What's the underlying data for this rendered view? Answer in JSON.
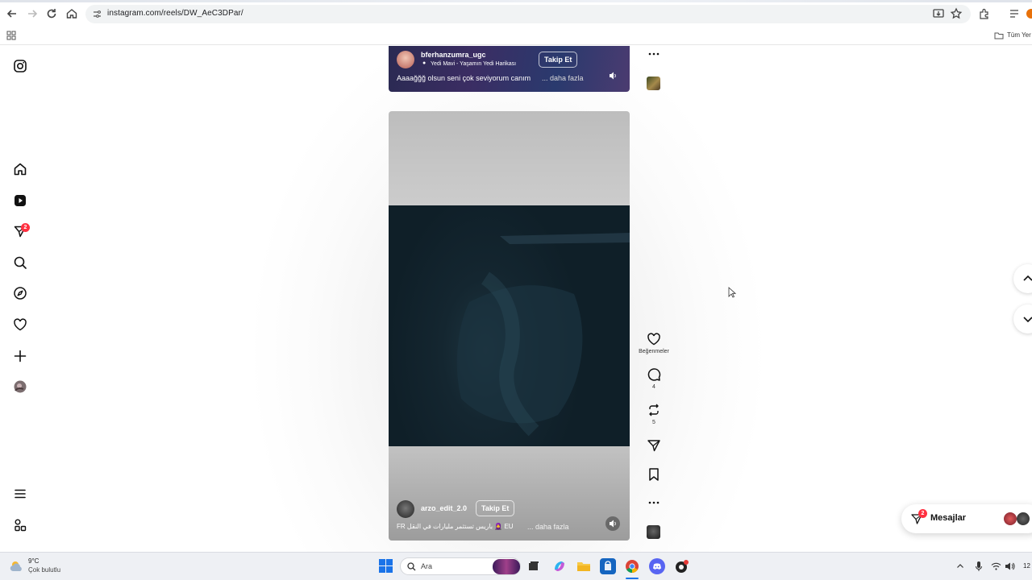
{
  "browser": {
    "url": "instagram.com/reels/DW_AeC3DPar/",
    "bookmarks_label": "Tüm Yer"
  },
  "sidebar": {
    "notifications_badge": "2"
  },
  "reels": [
    {
      "username": "bferhanzumra_ugc",
      "location": "Yedi Mavi - Yaşamın Yedi Harikası",
      "caption": "Aaaağğğ olsun seni çok seviyorum canım",
      "more": "... daha fazla",
      "follow_label": "Takip Et"
    },
    {
      "username": "arzo_edit_2.0",
      "caption": "FR باريس تستثمر مليارات في النقل 🧕 EU",
      "more": "... daha fazla",
      "follow_label": "Takip Et"
    }
  ],
  "actions": {
    "likes_label": "Beğenmeler",
    "comments_count": "4",
    "reposts_count": "5"
  },
  "messages": {
    "label": "Mesajlar",
    "badge": "2"
  },
  "taskbar": {
    "weather_temp": "9°C",
    "weather_desc": "Çok bulutlu",
    "search_placeholder": "Ara",
    "clock": "12"
  }
}
